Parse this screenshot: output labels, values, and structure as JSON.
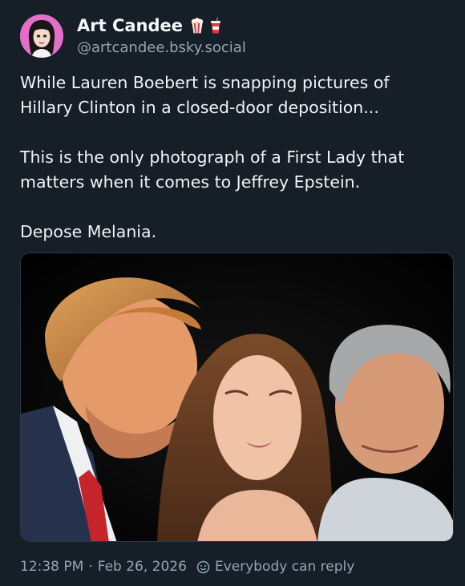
{
  "author": {
    "display_name": "Art Candee",
    "emoji": [
      "popcorn-icon",
      "soda-cup-icon"
    ],
    "handle": "@artcandee.bsky.social"
  },
  "post": {
    "paragraphs": [
      "While Lauren Boebert is snapping pictures of\nHillary Clinton in a closed-door deposition...",
      "This is the only photograph of a First Lady that\nmatters when it comes to Jeffrey Epstein.",
      "Depose Melania."
    ],
    "image_icon": "photo-icon"
  },
  "footer": {
    "time": "12:38 PM",
    "separator": "·",
    "date": "Feb 26, 2026",
    "reply_icon": "reply-settings-icon",
    "reply_setting": "Everybody can reply"
  },
  "colors": {
    "background": "#161e27",
    "text": "#f1f3f5",
    "muted": "#93a5b7",
    "avatar_bg": "#e46fc8"
  }
}
